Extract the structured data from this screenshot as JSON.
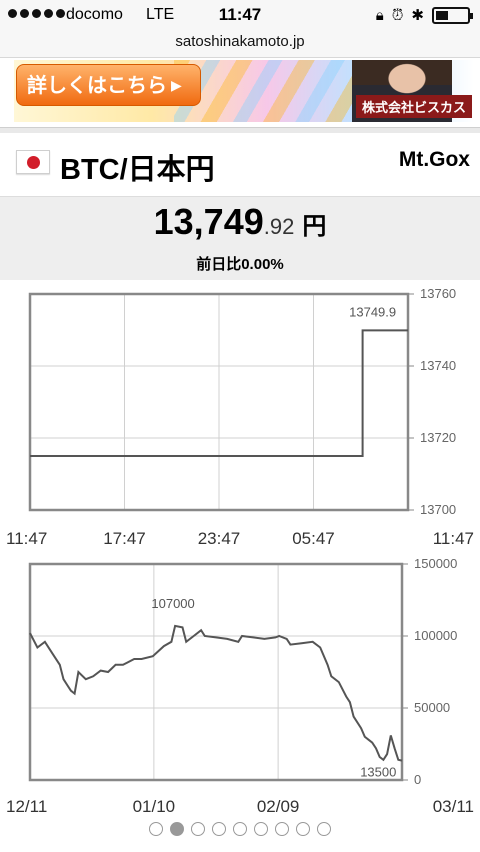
{
  "status_bar": {
    "carrier": "docomo",
    "network": "LTE",
    "time": "11:47"
  },
  "browser": {
    "url": "satoshinakamoto.jp"
  },
  "ad": {
    "button_label": "詳しくはこちら",
    "company": "株式会社ビスカス"
  },
  "ticker": {
    "pair": "BTC/日本円",
    "exchange": "Mt.Gox",
    "price_int": "13,749",
    "price_dec": ".92",
    "price_unit": "円",
    "change": "前日比0.00%"
  },
  "chart_data": [
    {
      "type": "line",
      "title": "",
      "x_labels": [
        "11:47",
        "17:47",
        "23:47",
        "05:47",
        "11:47"
      ],
      "y_ticks": [
        13700,
        13720,
        13740,
        13760
      ],
      "ylim": [
        13700,
        13760
      ],
      "grid": true,
      "series": [
        {
          "points": [
            [
              0,
              13715
            ],
            [
              0.88,
              13715
            ],
            [
              0.88,
              13749.9
            ],
            [
              1,
              13749.9
            ]
          ]
        }
      ],
      "annotations": [
        {
          "label": "13749.9",
          "x": 0.88,
          "y": 13749.9
        }
      ]
    },
    {
      "type": "line",
      "title": "",
      "x_labels": [
        "12/11",
        "01/10",
        "02/09",
        "03/11"
      ],
      "y_ticks": [
        0,
        50000,
        100000,
        150000
      ],
      "ylim": [
        0,
        150000
      ],
      "grid": true,
      "series": [
        {
          "points": [
            [
              0,
              102000
            ],
            [
              0.02,
              92000
            ],
            [
              0.04,
              96000
            ],
            [
              0.06,
              88000
            ],
            [
              0.08,
              80000
            ],
            [
              0.09,
              70000
            ],
            [
              0.1,
              66000
            ],
            [
              0.11,
              62000
            ],
            [
              0.12,
              60000
            ],
            [
              0.13,
              75000
            ],
            [
              0.15,
              70000
            ],
            [
              0.17,
              72000
            ],
            [
              0.19,
              76000
            ],
            [
              0.21,
              75000
            ],
            [
              0.23,
              80000
            ],
            [
              0.25,
              80000
            ],
            [
              0.28,
              84000
            ],
            [
              0.3,
              84000
            ],
            [
              0.33,
              86000
            ],
            [
              0.36,
              93000
            ],
            [
              0.38,
              96000
            ],
            [
              0.39,
              107000
            ],
            [
              0.41,
              106000
            ],
            [
              0.42,
              96000
            ],
            [
              0.44,
              100000
            ],
            [
              0.46,
              104000
            ],
            [
              0.47,
              100000
            ],
            [
              0.5,
              99000
            ],
            [
              0.53,
              98000
            ],
            [
              0.56,
              96000
            ],
            [
              0.57,
              100000
            ],
            [
              0.6,
              99000
            ],
            [
              0.63,
              98000
            ],
            [
              0.66,
              99000
            ],
            [
              0.67,
              100000
            ],
            [
              0.69,
              98000
            ],
            [
              0.7,
              94000
            ],
            [
              0.73,
              95000
            ],
            [
              0.76,
              96000
            ],
            [
              0.78,
              92000
            ],
            [
              0.8,
              80000
            ],
            [
              0.81,
              72000
            ],
            [
              0.83,
              68000
            ],
            [
              0.85,
              58000
            ],
            [
              0.86,
              54000
            ],
            [
              0.87,
              44000
            ],
            [
              0.89,
              36000
            ],
            [
              0.9,
              30000
            ],
            [
              0.91,
              28000
            ],
            [
              0.92,
              26000
            ],
            [
              0.93,
              22000
            ],
            [
              0.94,
              16000
            ],
            [
              0.95,
              14000
            ],
            [
              0.96,
              18000
            ],
            [
              0.97,
              31000
            ],
            [
              0.98,
              22000
            ],
            [
              0.99,
              14000
            ],
            [
              1,
              13500
            ]
          ]
        }
      ],
      "annotations": [
        {
          "label": "107000",
          "x": 0.39,
          "y": 107000
        },
        {
          "label": "13500",
          "x": 0.99,
          "y": 13500
        }
      ]
    }
  ],
  "pager": {
    "count": 9,
    "active": 1
  }
}
